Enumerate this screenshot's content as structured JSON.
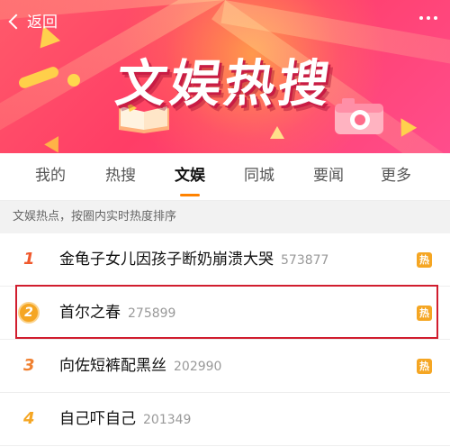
{
  "banner": {
    "title": "文娱热搜",
    "back_label": "返回"
  },
  "tabs": [
    {
      "label": "我的"
    },
    {
      "label": "热搜"
    },
    {
      "label": "文娱"
    },
    {
      "label": "同城"
    },
    {
      "label": "要闻"
    },
    {
      "label": "更多"
    }
  ],
  "active_tab": "文娱",
  "subtitle": "文娱热点，按圈内实时热度排序",
  "items": [
    {
      "rank": "1",
      "title": "金龟子女儿因孩子断奶崩溃大哭",
      "count": "573877",
      "badge": "热"
    },
    {
      "rank": "2",
      "title": "首尔之春",
      "count": "275899",
      "badge": "热",
      "highlighted": true
    },
    {
      "rank": "3",
      "title": "向佐短裤配黑丝",
      "count": "202990",
      "badge": "热"
    },
    {
      "rank": "4",
      "title": "自己吓自己",
      "count": "201349"
    }
  ],
  "colors": {
    "accent": "#ff8200",
    "banner": "#ff3d66",
    "hot_badge": "#f5a623",
    "highlight_border": "#d11d2e"
  },
  "icons": {
    "back": "chevron-left-icon",
    "more": "more-dots-icon",
    "hot": "hot-badge-icon"
  }
}
